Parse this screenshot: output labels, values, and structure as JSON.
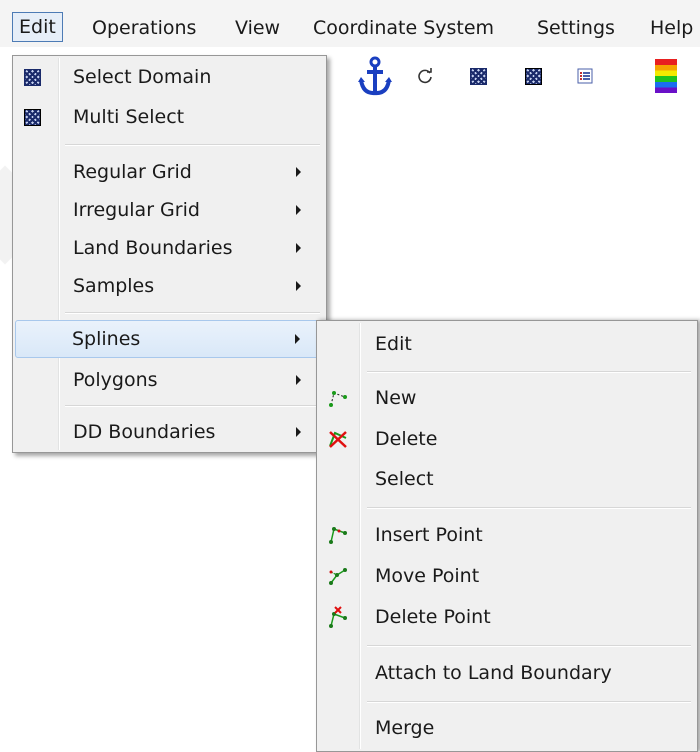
{
  "menubar": {
    "items": [
      "Edit",
      "Operations",
      "View",
      "Coordinate System",
      "Settings",
      "Help"
    ]
  },
  "toolbar": {
    "icons": [
      "anchor-icon",
      "refresh-icon",
      "grid-select-icon",
      "grid-multi-icon",
      "list-icon",
      "color-scale-icon"
    ]
  },
  "edit_menu": {
    "items": [
      {
        "label": "Select Domain",
        "icon": "select-domain-icon"
      },
      {
        "label": "Multi Select",
        "icon": "multi-select-icon"
      },
      {
        "label": "Regular Grid",
        "submenu": true
      },
      {
        "label": "Irregular Grid",
        "submenu": true
      },
      {
        "label": "Land Boundaries",
        "submenu": true
      },
      {
        "label": "Samples",
        "submenu": true
      },
      {
        "label": "Splines",
        "submenu": true,
        "highlighted": true
      },
      {
        "label": "Polygons",
        "submenu": true
      },
      {
        "label": "DD Boundaries",
        "submenu": true
      }
    ]
  },
  "splines_menu": {
    "items": [
      {
        "label": "Edit"
      },
      {
        "label": "New",
        "icon": "spline-new-icon"
      },
      {
        "label": "Delete",
        "icon": "spline-delete-icon"
      },
      {
        "label": "Select"
      },
      {
        "label": "Insert Point",
        "icon": "insert-point-icon"
      },
      {
        "label": "Move Point",
        "icon": "move-point-icon"
      },
      {
        "label": "Delete Point",
        "icon": "delete-point-icon"
      },
      {
        "label": "Attach to Land Boundary"
      },
      {
        "label": "Merge"
      }
    ]
  },
  "colors": {
    "accent": "#4d7bb5",
    "highlight": "#d9e8f8",
    "menu_bg": "#f0f0f0"
  }
}
